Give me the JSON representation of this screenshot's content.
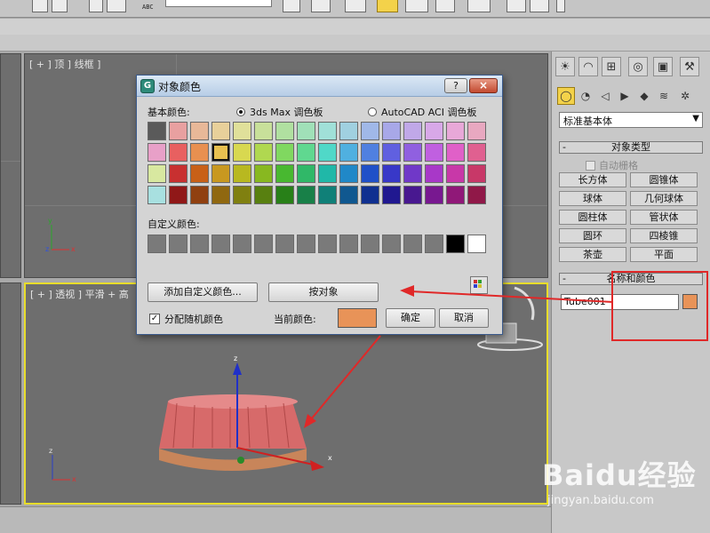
{
  "colors": {
    "accent_yellow": "#f3d24a",
    "viewport_active_border": "#e8dd2a",
    "annotation_red": "#e02828",
    "object_color": "#e89358"
  },
  "toolbar": {
    "abc_text": "ABC",
    "icons": [
      "select-icon",
      "move-icon",
      "rotate-icon",
      "scale-icon",
      "snap-icon",
      "mirror-icon",
      "align-icon",
      "layer-icon",
      "curve-icon",
      "schematic-icon",
      "material-icon",
      "render-setup-icon",
      "render-icon",
      "render-frame-icon"
    ]
  },
  "viewports": {
    "top_left_label": "[ + ] 顶 ] 线框 ]",
    "bottom_left_label": "[ + ] 透视 ] 平滑 + 高"
  },
  "command_panel": {
    "tabs": [
      "create-tab-icon",
      "modify-tab-icon",
      "hierarchy-tab-icon",
      "motion-tab-icon",
      "display-tab-icon",
      "utilities-tab-icon"
    ],
    "subtabs": [
      "geometry-icon",
      "shapes-icon",
      "lights-icon",
      "cameras-icon",
      "helpers-icon",
      "spacewarps-icon",
      "systems-icon"
    ],
    "category_dropdown": "标准基本体",
    "object_type": {
      "title": "对象类型",
      "autogrid_label": "自动栅格",
      "buttons": [
        "长方体",
        "圆锥体",
        "球体",
        "几何球体",
        "圆柱体",
        "管状体",
        "圆环",
        "四棱锥",
        "茶壶",
        "平面"
      ]
    },
    "name_color": {
      "title": "名称和颜色",
      "name_value": "Tube001"
    }
  },
  "dialog": {
    "title": "对象颜色",
    "help_label": "?",
    "close_label": "×",
    "basic_colors_label": "基本颜色:",
    "radio_3dsmax": "3ds Max 调色板",
    "radio_autocad": "AutoCAD ACI 调色板",
    "basic_swatches": [
      "#5a5a5a",
      "#e8a0a0",
      "#e8b898",
      "#e8d09a",
      "#e0e09a",
      "#c8e09a",
      "#b0e0a0",
      "#a0e0b8",
      "#a0e0d8",
      "#a0d0e0",
      "#a0b8e8",
      "#a8a8e8",
      "#c0a8e8",
      "#d8a8e8",
      "#e8a8d8",
      "#e8a8c0",
      "#e8a0c8",
      "#e86060",
      "#e89050",
      "#e8c050",
      "#d8d850",
      "#b0d850",
      "#80d860",
      "#60d890",
      "#50d8c8",
      "#50b0e0",
      "#5080e0",
      "#6060e0",
      "#9060e0",
      "#c060e0",
      "#e060c8",
      "#e06090",
      "#d8e8a0",
      "#c83030",
      "#c86018",
      "#c89820",
      "#b8b820",
      "#88b820",
      "#48b830",
      "#30b868",
      "#20b8a8",
      "#2088c8",
      "#2050c8",
      "#3838c8",
      "#7038c8",
      "#a838c8",
      "#c838a8",
      "#c83868",
      "#a8e0e0",
      "#901818",
      "#904010",
      "#906810",
      "#808010",
      "#588010",
      "#288018",
      "#188048",
      "#108078",
      "#105890",
      "#103090",
      "#201890",
      "#481890",
      "#781890",
      "#901878",
      "#901848"
    ],
    "selected_swatch_index": 19,
    "custom_colors_label": "自定义颜色:",
    "custom_swatches": [
      "#7a7a7a",
      "#7a7a7a",
      "#7a7a7a",
      "#7a7a7a",
      "#7a7a7a",
      "#7a7a7a",
      "#7a7a7a",
      "#7a7a7a",
      "#7a7a7a",
      "#7a7a7a",
      "#7a7a7a",
      "#7a7a7a",
      "#7a7a7a",
      "#7a7a7a",
      "#000000",
      "#ffffff"
    ],
    "add_custom_label": "添加自定义颜色...",
    "by_object_label": "按对象",
    "random_color_label": "分配随机颜色",
    "random_color_checked": "✓",
    "current_color_label": "当前颜色:",
    "current_color": "#e89358",
    "ok_label": "确定",
    "cancel_label": "取消"
  },
  "watermark": {
    "brand": "Baidu经验",
    "url": "jingyan.baidu.com"
  }
}
